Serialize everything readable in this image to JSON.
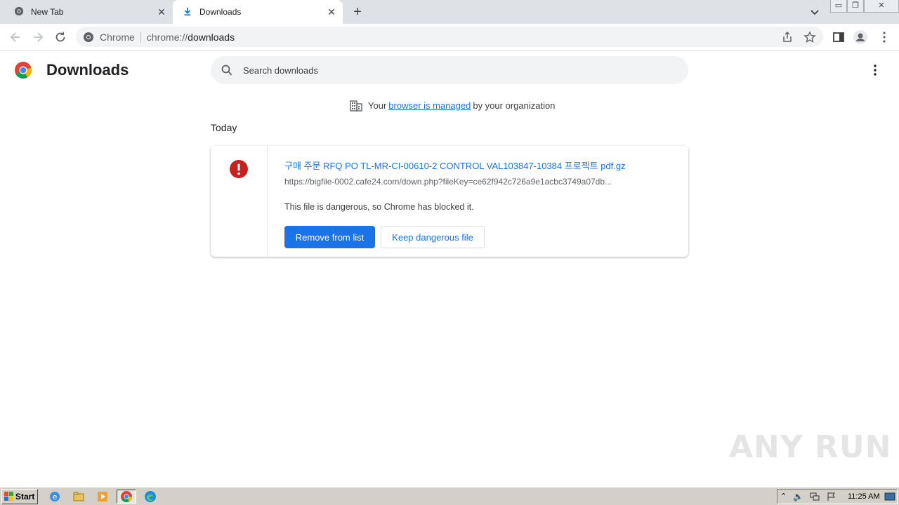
{
  "tabs": [
    {
      "title": "New Tab"
    },
    {
      "title": "Downloads"
    }
  ],
  "omnibox": {
    "site_name": "Chrome",
    "url_scheme": "chrome://",
    "url_path": "downloads"
  },
  "page": {
    "title": "Downloads",
    "search_placeholder": "Search downloads",
    "managed_prefix": "Your",
    "managed_link": "browser is managed",
    "managed_suffix": "by your organization",
    "section_label": "Today"
  },
  "download": {
    "file_name": "구매 주문 RFQ PO TL-MR-CI-00610-2 CONTROL VAL103847-10384 프로젝트 pdf.gz",
    "url": "https://bigfile-0002.cafe24.com/down.php?fileKey=ce62f942c726a9e1acbc3749a07db...",
    "status": "This file is dangerous, so Chrome has blocked it.",
    "remove_label": "Remove from list",
    "keep_label": "Keep dangerous file"
  },
  "watermark": "ANY RUN",
  "taskbar": {
    "start_label": "Start",
    "clock": "11:25 AM"
  },
  "colors": {
    "accent": "#1a73e8",
    "danger": "#c5221f",
    "tabstrip": "#dee1e6"
  }
}
